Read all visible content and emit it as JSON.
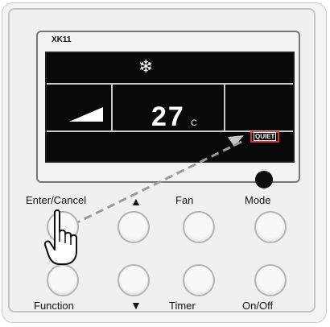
{
  "device": {
    "model": "XK11",
    "temperature": "27",
    "temperature_unit": "°C",
    "mode_icon": "snowflake-icon",
    "quiet_badge": "QUIET",
    "arrow_up": "▲",
    "arrow_down": "▼"
  },
  "buttons": {
    "enter_cancel": "Enter/Cancel",
    "function": "Function",
    "fan": "Fan",
    "timer": "Timer",
    "mode": "Mode",
    "on_off": "On/Off"
  },
  "colors": {
    "lcd_background": "#080808",
    "lcd_text": "#ffffff",
    "quiet_highlight": "#e0303a",
    "panel": "#f0f0f0"
  }
}
